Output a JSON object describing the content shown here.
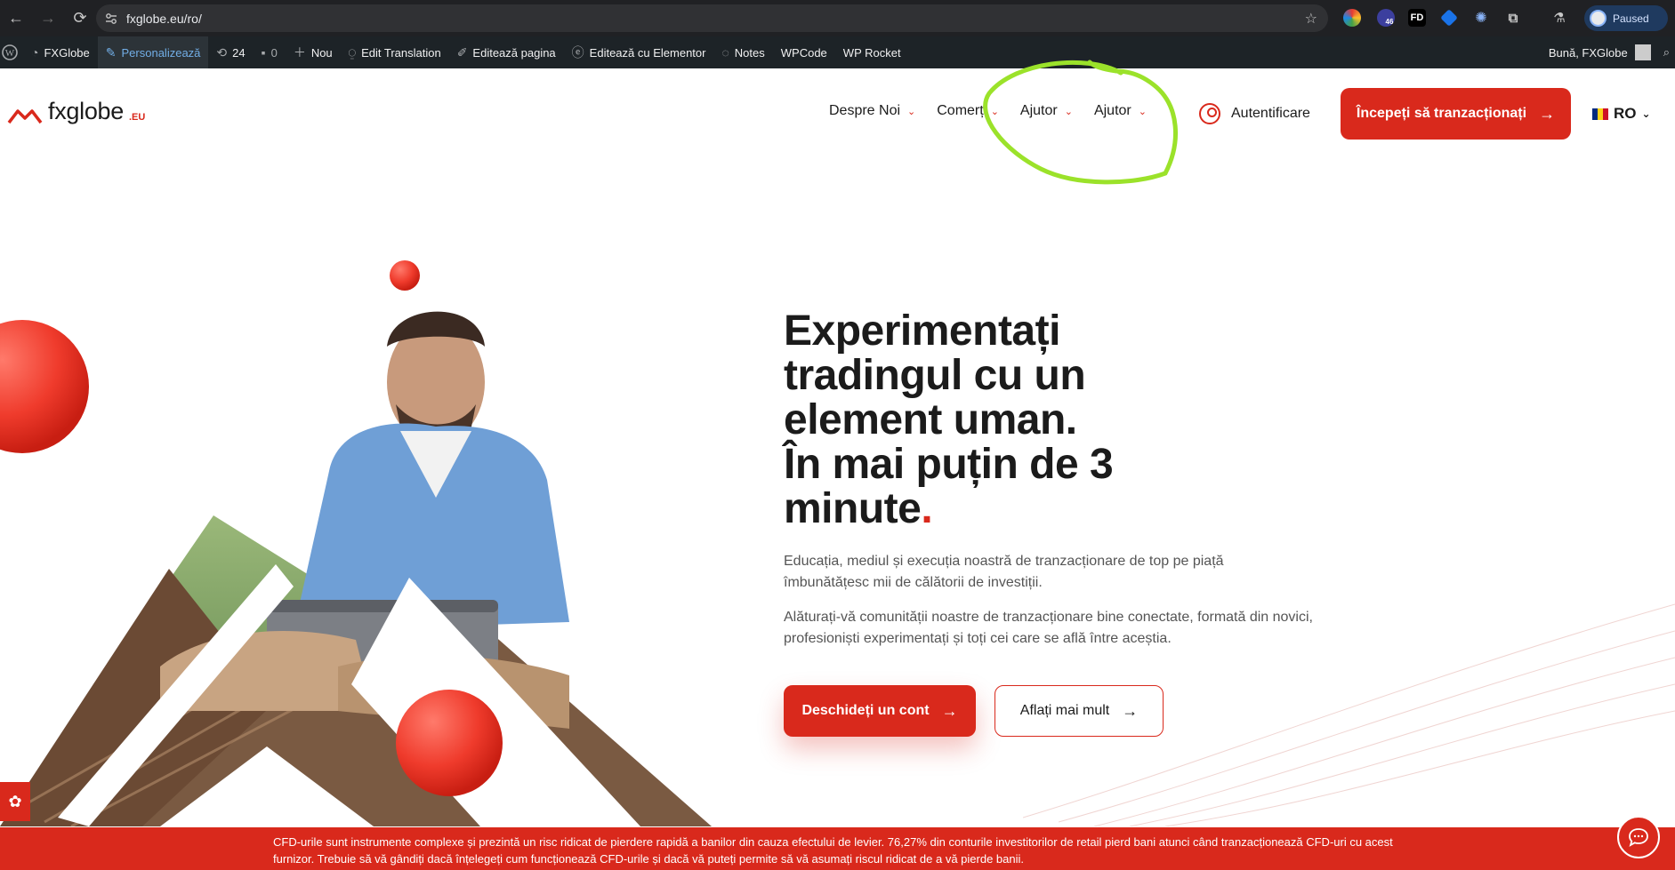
{
  "browser": {
    "url": "fxglobe.eu/ro/",
    "profile_status": "Paused",
    "extension_badge": "46",
    "extension_fd": "FD"
  },
  "adminbar": {
    "items": [
      {
        "label": "FXGlobe",
        "icon": "dashboard-icon"
      },
      {
        "label": "Personalizează",
        "icon": "brush-icon"
      },
      {
        "label": "24",
        "icon": "updates-icon"
      },
      {
        "label": "0",
        "icon": "comment-icon"
      },
      {
        "label": "Nou",
        "icon": "plus-icon"
      },
      {
        "label": "Edit Translation",
        "icon": "translate-icon"
      },
      {
        "label": "Editează pagina",
        "icon": "pencil-icon"
      },
      {
        "label": "Editează cu Elementor",
        "icon": "elementor-icon"
      },
      {
        "label": "Notes",
        "icon": "notes-icon"
      },
      {
        "label": "WPCode",
        "icon": ""
      },
      {
        "label": "WP Rocket",
        "icon": ""
      }
    ],
    "greeting": "Bună, FXGlobe"
  },
  "header": {
    "logo_text": "fxglobe",
    "logo_suffix": ".EU",
    "nav": [
      "Despre Noi",
      "Comerț",
      "Ajutor",
      "Ajutor"
    ],
    "login_label": "Autentificare",
    "cta_label": "Începeți să tranzacționați",
    "language": "RO"
  },
  "hero": {
    "title_lines": [
      "Experimentați",
      "tradingul cu un",
      "element uman.",
      "În mai puțin de 3",
      "minute"
    ],
    "title_end": ".",
    "paragraph_1": "Educația, mediul și execuția noastră de tranzacționare de top pe piață îmbunătățesc mii de călătorii de investiții.",
    "paragraph_2": "Alăturați-vă comunității noastre de tranzacționare bine conectate, formată din novici, profesioniști experimentați și toți cei care se află între aceștia.",
    "primary_button": "Deschideți un cont",
    "secondary_button": "Aflați mai mult"
  },
  "risk_banner": "CFD-urile sunt instrumente complexe și prezintă un risc ridicat de pierdere rapidă a banilor din cauza efectului de levier. 76,27% din conturile investitorilor de retail pierd bani atunci când tranzacționează CFD-uri cu acest furnizor. Trebuie să vă gândiți dacă înțelegeți cum funcționează CFD-urile și dacă vă puteți permite să vă asumați riscul ridicat de a vă pierde banii.",
  "colors": {
    "brand_red": "#d9291c",
    "annotation_green": "#9be22a",
    "admin_bar": "#1d2327",
    "chrome_bg": "#202124"
  }
}
